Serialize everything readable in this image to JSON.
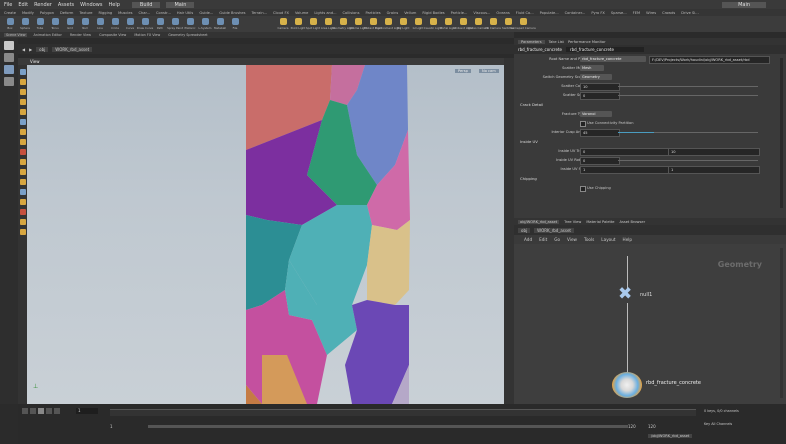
{
  "menubar": {
    "items": [
      "File",
      "Edit",
      "Render",
      "Assets",
      "Windows",
      "Help"
    ],
    "desktop": "Build",
    "branch": "Main",
    "workspace": "Main"
  },
  "shelf_tabs": [
    "Create",
    "Modify",
    "Polygon",
    "Deform",
    "Texture",
    "Rigging",
    "Muscles",
    "Char...",
    "Constr...",
    "Hair Utils",
    "Guide...",
    "Guide Brushes",
    "Terrain...",
    "Cloud FX",
    "Volume",
    "Lights and...",
    "Collisions",
    "Particles",
    "Grains",
    "Vellum",
    "Rigid Bodies",
    "Particle...",
    "Viscous...",
    "Oceans",
    "Fluid Co...",
    "Populate...",
    "Container...",
    "Pyro FX",
    "Sparse...",
    "FEM",
    "Wires",
    "Crowds",
    "Drive Si..."
  ],
  "shelf_tools": [
    "Box",
    "Sphere",
    "Tube",
    "Torus",
    "Grid",
    "Null",
    "Line",
    "Circle",
    "Curve",
    "Draw Curve",
    "Path",
    "Spray Paint",
    "Platonic",
    "L-System",
    "Metaball",
    "File"
  ],
  "light_tools": [
    "Camera",
    "Point Light",
    "Spot Light",
    "Area Light",
    "Geometry Light",
    "Volume Light",
    "Distant Light",
    "Environment Light",
    "Sky Light",
    "GI Light",
    "Caustic Light",
    "Portal Light",
    "Ambient Light",
    "Stereo Camera",
    "VR Camera",
    "Switcher",
    "Gamepad Camera"
  ],
  "pane_tabs": [
    "Scene View",
    "Animation Editor",
    "Render View",
    "Composite View",
    "Motion FX View",
    "Geometry Spreadsheet"
  ],
  "path": {
    "context": "obj",
    "node": "WORK_rbd_asset"
  },
  "viewport": {
    "label": "View",
    "persp": "Persp",
    "cam": "No cam"
  },
  "params": {
    "node_type": "rbd_fracture_concrete",
    "node_name": "rbd_fracture_concrete",
    "tabs": [
      "Take List",
      "Performance Monitor"
    ],
    "root_label": "Root Name and Path",
    "root_value": "rbd_fracture_concrete",
    "path_value": "F:/DEV/Projects/Work/houdini/obj/WORK_rbd_asset/rbd",
    "scatter_mode_label": "Scatter Mode",
    "scatter_mode_value": "Mesh",
    "switch_label": "Switch Geometry Scat...",
    "switch_value": "Geometry",
    "scatter_count_label": "Scatter Count",
    "scatter_count_value": "10",
    "scatter_seed_label": "Scatter Seed",
    "scatter_seed_value": "0",
    "crack_section": "Crack Detail",
    "fracture_type_label": "Fracture Type",
    "fracture_type_value": "Voronoi",
    "connectivity_label": "Use Connectivity Partition",
    "interior_cusp_label": "Interior Cusp Angle",
    "interior_cusp_value": "45",
    "inside_uv_section": "Inside UV",
    "inside_uv_trans_label": "Inside UV Trans",
    "inside_uv_trans_x": "0",
    "inside_uv_trans_y": "10",
    "inside_uv_rotate_label": "Inside UV Rotate",
    "inside_uv_rotate_value": "0",
    "inside_uv_size_label": "Inside UV Size",
    "inside_uv_size_x": "1",
    "inside_uv_size_y": "1",
    "chipping_section": "Chipping",
    "use_chipping_label": "Use Chipping"
  },
  "network": {
    "tabs": [
      "obj/WORK_rbd_asset",
      "Tree View",
      "Material Palette",
      "Asset Browser"
    ],
    "menu": [
      "Add",
      "Edit",
      "Go",
      "View",
      "Tools",
      "Layout",
      "Help"
    ],
    "context_label": "Geometry",
    "null_node": "null1",
    "fracture_node": "rbd_fracture_concrete"
  },
  "timeline": {
    "current_frame": "1",
    "start": "1",
    "end": "120",
    "end2": "120",
    "keys_label": "0 keys, 0/0 channels",
    "auto_label": "Key All Channels",
    "status": "/obj/WORK_rbd_asset"
  },
  "colors": {
    "accent": "#d7a640",
    "viewport_bg": "#bfc8d0"
  }
}
